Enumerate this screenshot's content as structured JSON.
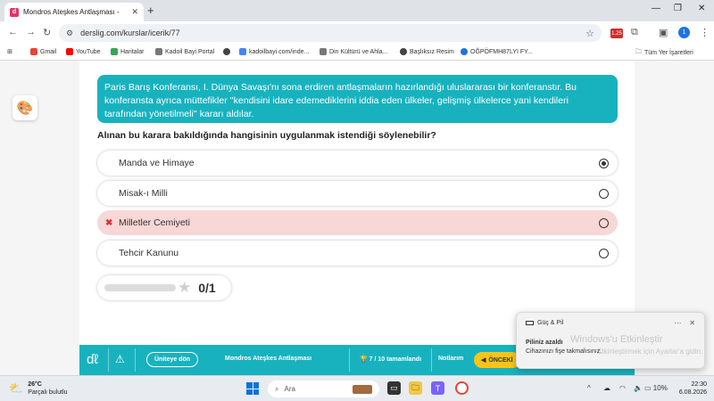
{
  "browser": {
    "tab_title": "Mondros Ateşkes Antlaşması - ",
    "tab_favicon": "d",
    "url": "derslig.com/kurslar/icerik/77",
    "extension_badge": "1.25",
    "profile_initial": "1"
  },
  "bookmarks": {
    "items": [
      {
        "label": "Gmail",
        "color": "#ea4335"
      },
      {
        "label": "YouTube",
        "color": "#ff0000"
      },
      {
        "label": "Haritalar",
        "color": "#34a853"
      },
      {
        "label": "Kadoil Bayi Portal",
        "color": "#777777"
      },
      {
        "label": "",
        "color": "#444444"
      },
      {
        "label": "kadoilbayi.com/inde...",
        "color": "#4285f4"
      },
      {
        "label": "Din Kültürü ve Ahla...",
        "color": "#777777"
      },
      {
        "label": "Başlıksız Resim",
        "color": "#444444"
      },
      {
        "label": "OĞPÖFMH87LYI FY...",
        "color": "#1a73e8"
      }
    ],
    "all_bookmarks": "Tüm Yer İşaretleri"
  },
  "question": {
    "text": "Paris Barış Konferansı, I. Dünya Savaşı'nı sona erdiren antlaşmaların hazırlandığı uluslararası bir konferanstır. Bu konferansta ayrıca müttefikler ''kendisini idare edemediklerini iddia eden ülkeler, gelişmiş ülkelerce yani kendileri tarafından yönetilmeli'' kararı aldılar.",
    "prompt": "Alınan bu karara bakıldığında hangisinin uygulanmak istendiği söylenebilir?",
    "options": [
      {
        "label": "Manda ve Himaye",
        "selected": true,
        "wrong": false
      },
      {
        "label": "Misak-ı Milli",
        "selected": false,
        "wrong": false
      },
      {
        "label": "Milletler Cemiyeti",
        "selected": false,
        "wrong": true
      },
      {
        "label": "Tehcir Kanunu",
        "selected": false,
        "wrong": false
      }
    ]
  },
  "score": {
    "text": "0/1",
    "progress": 1.0
  },
  "lesson_bar": {
    "back": "Üniteye dön",
    "title": "Mondros Ateşkes Antlaşması",
    "progress": "7 / 10 tamamlandı",
    "notes": "Notlarım",
    "prev": "ÖNCEKİ"
  },
  "toast": {
    "app": "Güç & Pil",
    "line1": "Piliniz azaldı",
    "line2": "Cihazınızı fişe takmalısınız.",
    "watermark1": "Windows'u Etkinleştir",
    "watermark2": "Etkinleştirmek için Ayarlar'a gidin."
  },
  "taskbar": {
    "temp": "26°C",
    "weather": "Parçalı bulutlu",
    "search": "Ara",
    "battery": "10%",
    "time": "22:30",
    "date": "6.08.2026"
  }
}
